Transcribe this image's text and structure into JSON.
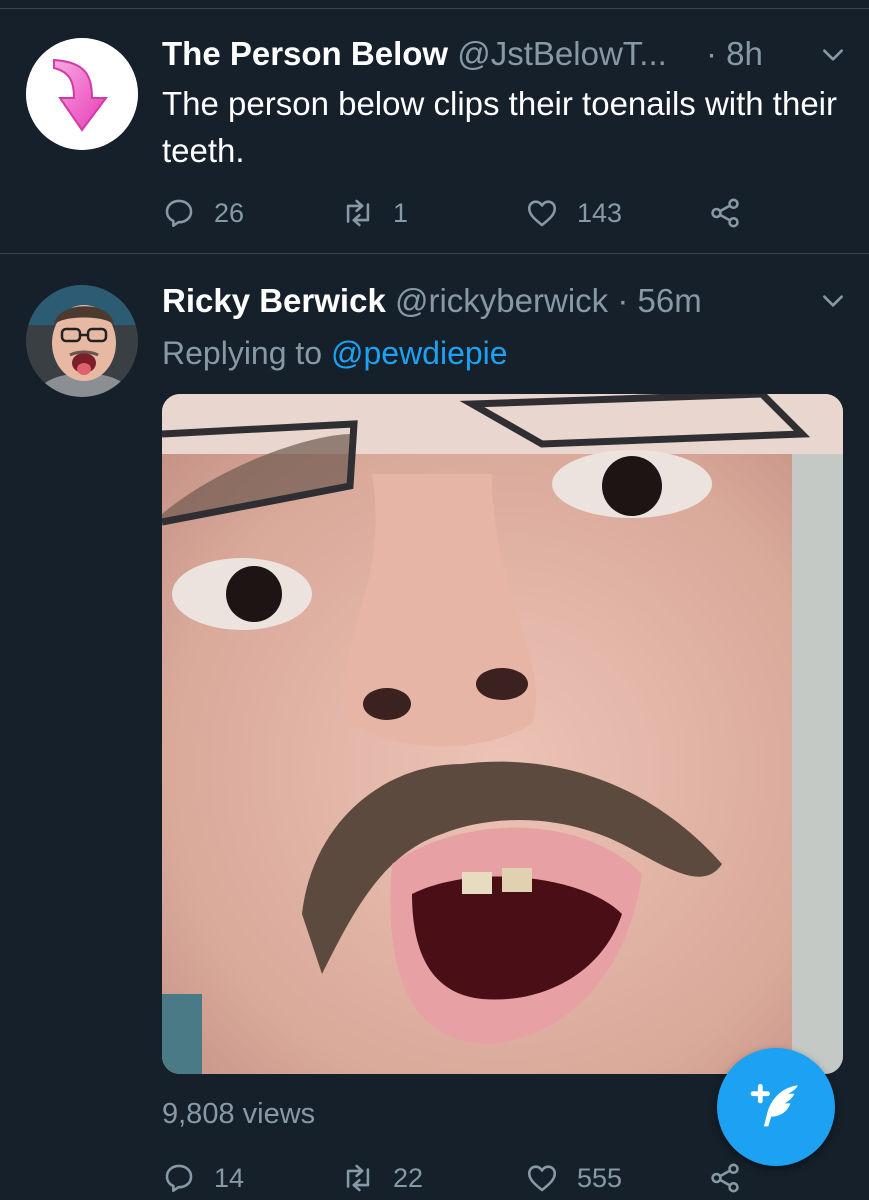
{
  "tweets": [
    {
      "name": "The Person Below",
      "handle": "@JstBelowT...",
      "time": "· 8h",
      "text": "The person below clips their toenails with their teeth.",
      "replies": "26",
      "retweets": "1",
      "likes": "143"
    },
    {
      "name": "Ricky Berwick",
      "handle": "@rickyberwick",
      "time": "· 56m",
      "replying_prefix": "Replying to",
      "replying_to": "@pewdiepie",
      "views": "9,808 views",
      "replies": "14",
      "retweets": "22",
      "likes": "555"
    }
  ],
  "icons": {
    "reply": "reply-icon",
    "retweet": "retweet-icon",
    "like": "heart-icon",
    "share": "share-icon",
    "more": "chevron-down-icon",
    "compose": "compose-tweet-icon"
  },
  "colors": {
    "background": "#15202b",
    "accent": "#1da1f2",
    "secondary_text": "#8899a6"
  }
}
